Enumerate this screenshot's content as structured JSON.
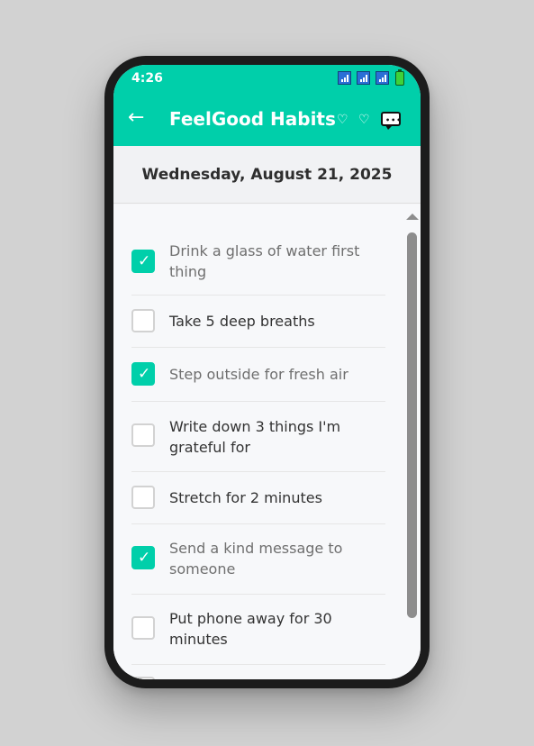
{
  "status_bar": {
    "time": "4:26"
  },
  "header": {
    "back_icon": "←",
    "title": "FeelGood Habits",
    "heart_icon": "♡"
  },
  "date": {
    "text": "Wednesday, August 21, 2025"
  },
  "habits": [
    {
      "label": "Drink a glass of water first thing",
      "checked": true
    },
    {
      "label": "Take 5 deep breaths",
      "checked": false
    },
    {
      "label": "Step outside for fresh air",
      "checked": true
    },
    {
      "label": "Write down 3 things I'm grateful for",
      "checked": false
    },
    {
      "label": "Stretch for 2 minutes",
      "checked": false
    },
    {
      "label": "Send a kind message to someone",
      "checked": true
    },
    {
      "label": "Put phone away for 30 minutes",
      "checked": false
    }
  ],
  "colors": {
    "accent": "#00cfaa",
    "phone_frame": "#1c1c1c",
    "background": "#d2d2d2"
  }
}
